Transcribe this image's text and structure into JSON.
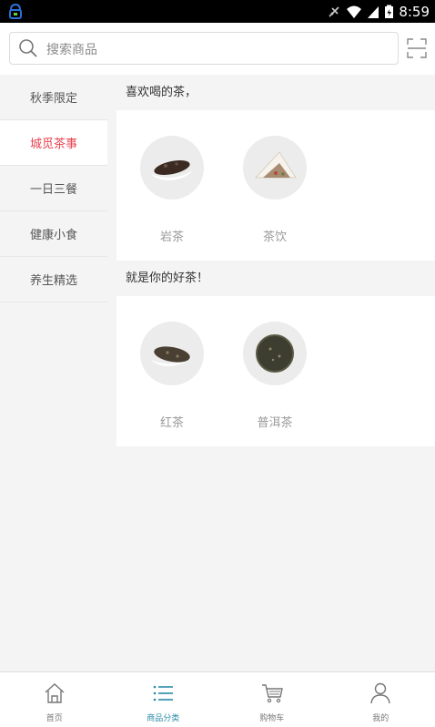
{
  "status_bar": {
    "time": "8:59"
  },
  "search": {
    "placeholder": "搜索商品"
  },
  "sidebar": {
    "items": [
      {
        "label": "秋季限定"
      },
      {
        "label": "城觅茶事"
      },
      {
        "label": "一日三餐"
      },
      {
        "label": "健康小食"
      },
      {
        "label": "养生精选"
      }
    ],
    "active_index": 1
  },
  "sections": [
    {
      "title": "喜欢喝的茶，",
      "items": [
        {
          "label": "岩茶"
        },
        {
          "label": "茶饮"
        }
      ]
    },
    {
      "title": "就是你的好茶！",
      "items": [
        {
          "label": "红茶"
        },
        {
          "label": "普洱茶"
        }
      ]
    }
  ],
  "tabbar": {
    "items": [
      {
        "label": "首页",
        "icon": "home-icon"
      },
      {
        "label": "商品分类",
        "icon": "category-list-icon"
      },
      {
        "label": "购物车",
        "icon": "cart-icon"
      },
      {
        "label": "我的",
        "icon": "user-icon"
      }
    ],
    "active_index": 1
  },
  "colors": {
    "accent_red": "#e8424f",
    "accent_teal": "#2a8aa6"
  }
}
